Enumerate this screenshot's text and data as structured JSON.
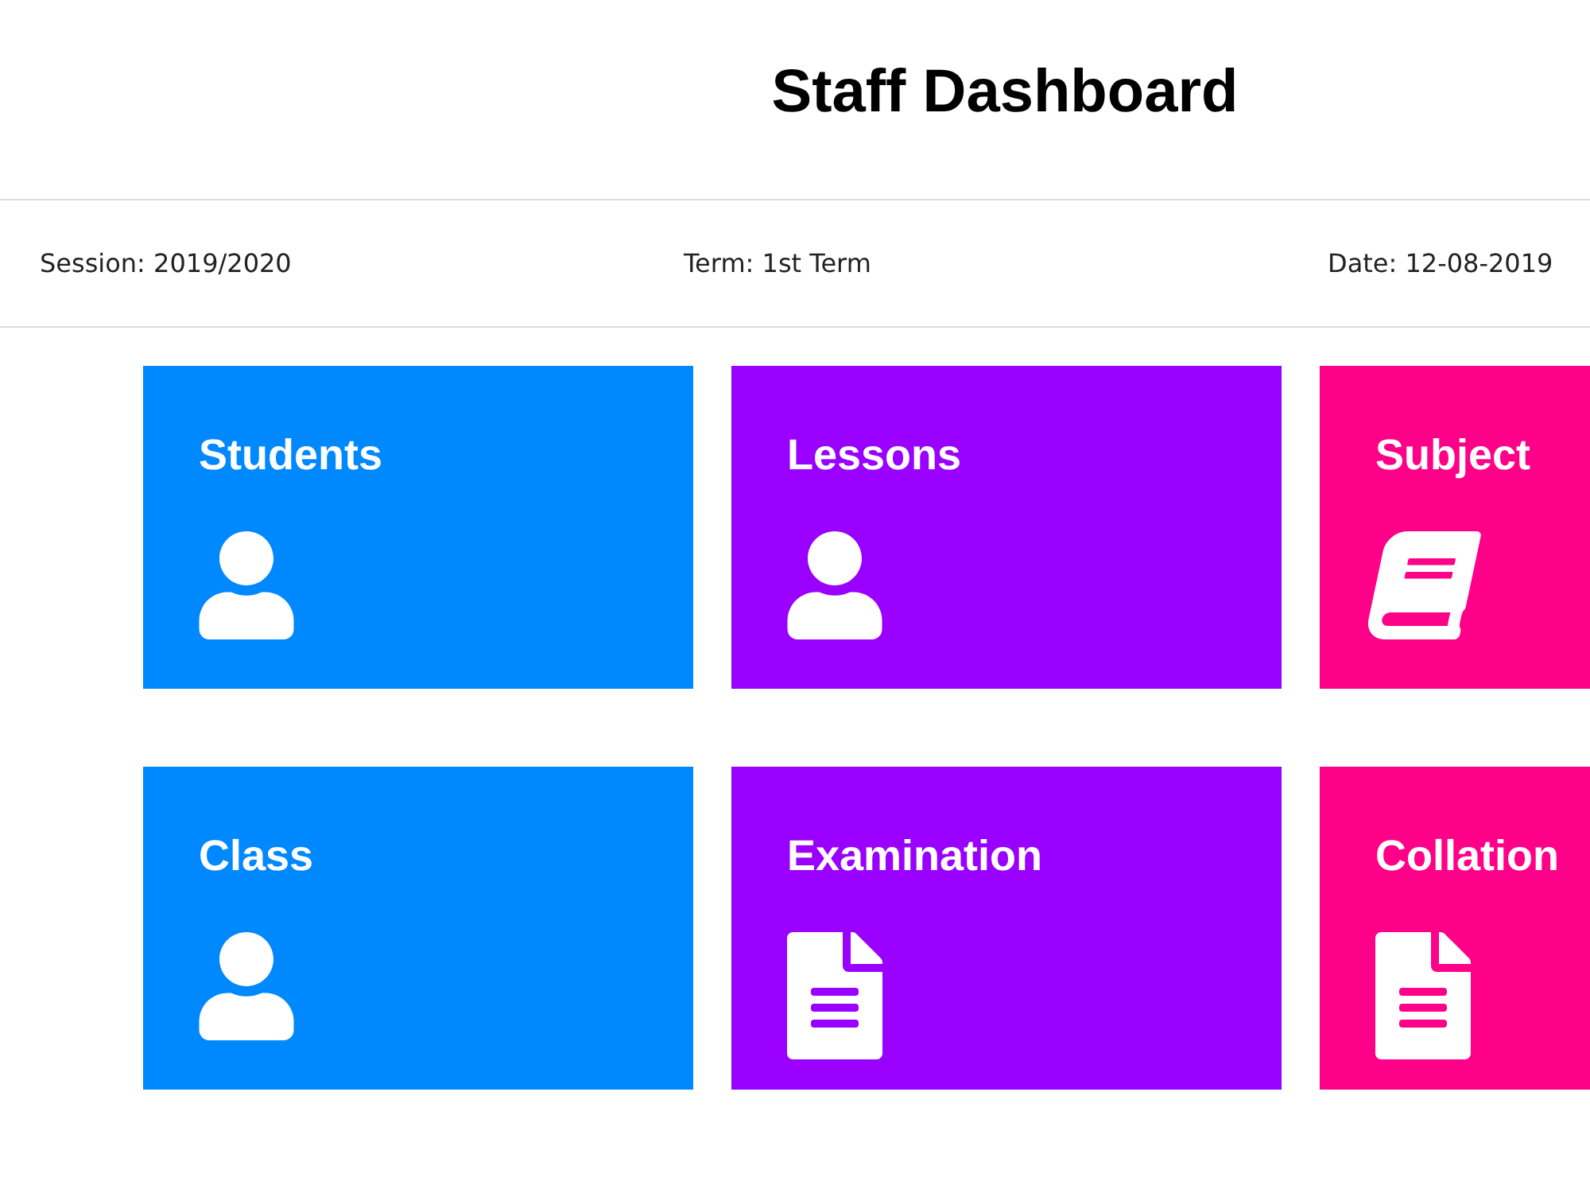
{
  "header": {
    "title": "Staff Dashboard"
  },
  "info_bar": {
    "session": "Session: 2019/2020",
    "term": "Term: 1st Term",
    "date": "Date: 12-08-2019"
  },
  "tiles": [
    {
      "label": "Students",
      "kind": "person",
      "color": "#0088ff"
    },
    {
      "label": "Lessons",
      "kind": "person",
      "color": "#9900ff"
    },
    {
      "label": "Subject",
      "kind": "book",
      "color": "#ff0088"
    },
    {
      "label": "Class",
      "kind": "person",
      "color": "#0088ff"
    },
    {
      "label": "Examination",
      "kind": "document",
      "color": "#9900ff"
    },
    {
      "label": "Collation",
      "kind": "document",
      "color": "#ff0088"
    }
  ]
}
